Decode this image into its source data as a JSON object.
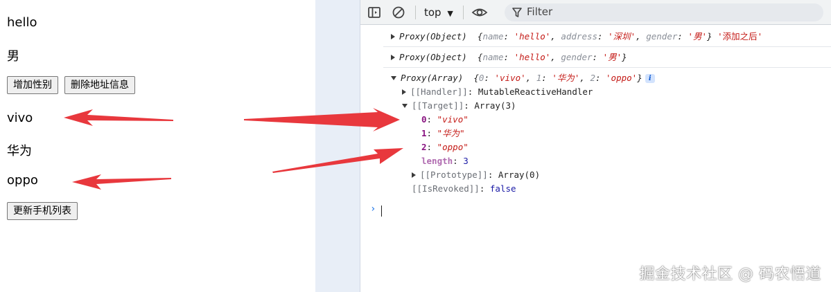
{
  "page": {
    "name_text": "hello",
    "gender_text": "男",
    "buttons": {
      "add_gender": "增加性别",
      "delete_address": "删除地址信息",
      "update_phones": "更新手机列表"
    },
    "phones": [
      "vivo",
      "华为",
      "oppo"
    ]
  },
  "devtools": {
    "toolbar": {
      "context": "top",
      "filter_placeholder": "Filter"
    },
    "console": {
      "msg1": {
        "type": "Proxy(Object)",
        "k_name": "name",
        "v_name": "'hello'",
        "k_address": "address",
        "v_address": "'深圳'",
        "k_gender": "gender",
        "v_gender": "'男'",
        "suffix": "'添加之后'"
      },
      "msg2": {
        "type": "Proxy(Object)",
        "k_name": "name",
        "v_name": "'hello'",
        "k_gender": "gender",
        "v_gender": "'男'"
      },
      "msg3": {
        "type": "Proxy(Array)",
        "k0": "0",
        "v0": "'vivo'",
        "k1": "1",
        "v1": "'华为'",
        "k2": "2",
        "v2": "'oppo'",
        "info": "i",
        "handler_key": "[[Handler]]",
        "handler_val": "MutableReactiveHandler",
        "target_key": "[[Target]]",
        "target_val": "Array(3)",
        "items": [
          {
            "key": "0",
            "val": "\"vivo\""
          },
          {
            "key": "1",
            "val": "\"华为\""
          },
          {
            "key": "2",
            "val": "\"oppo\""
          }
        ],
        "length_key": "length",
        "length_val": "3",
        "proto_key": "[[Prototype]]",
        "proto_val": "Array(0)",
        "revoked_key": "[[IsRevoked]]",
        "revoked_val": "false"
      }
    }
  },
  "watermark": "掘金技术社区 @ 码农悟道",
  "colors": {
    "arrow": "#e8383d",
    "string": "#c41a16",
    "property": "#881280",
    "number": "#1a1aa6",
    "prompt": "#1a73e8"
  }
}
